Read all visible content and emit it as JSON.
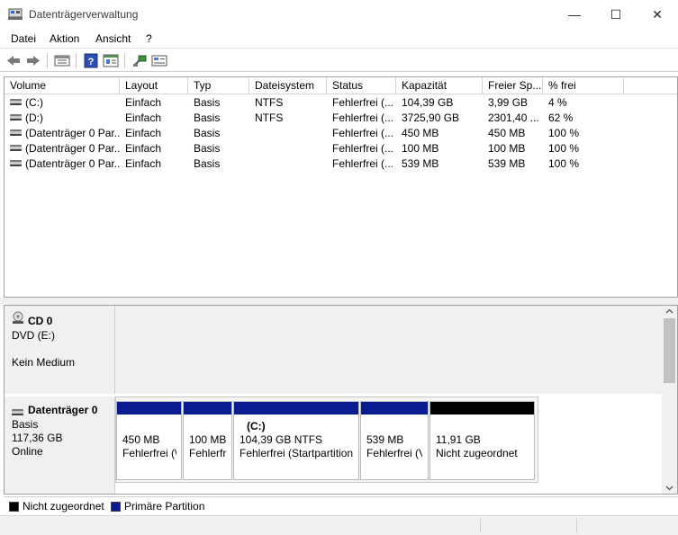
{
  "window": {
    "title": "Datenträgerverwaltung",
    "minimize_glyph": "—",
    "maximize_glyph": "☐",
    "close_glyph": "✕"
  },
  "menu": [
    "Datei",
    "Aktion",
    "Ansicht",
    "?"
  ],
  "toolbar_icons": [
    "back-arrow-icon",
    "forward-arrow-icon",
    "disk-list-icon",
    "help-icon",
    "properties-icon",
    "connect-icon",
    "console-icon"
  ],
  "columns": [
    "Volume",
    "Layout",
    "Typ",
    "Dateisystem",
    "Status",
    "Kapazität",
    "Freier Sp...",
    "% frei"
  ],
  "volumes": [
    {
      "volume": "(C:)",
      "layout": "Einfach",
      "typ": "Basis",
      "fs": "NTFS",
      "status": "Fehlerfrei (...",
      "cap": "104,39 GB",
      "free": "3,99 GB",
      "pct": "4 %"
    },
    {
      "volume": "(D:)",
      "layout": "Einfach",
      "typ": "Basis",
      "fs": "NTFS",
      "status": "Fehlerfrei (...",
      "cap": "3725,90 GB",
      "free": "2301,40 ...",
      "pct": "62 %"
    },
    {
      "volume": "(Datenträger 0 Par...",
      "layout": "Einfach",
      "typ": "Basis",
      "fs": "",
      "status": "Fehlerfrei (...",
      "cap": "450 MB",
      "free": "450 MB",
      "pct": "100 %"
    },
    {
      "volume": "(Datenträger 0 Par...",
      "layout": "Einfach",
      "typ": "Basis",
      "fs": "",
      "status": "Fehlerfrei (...",
      "cap": "100 MB",
      "free": "100 MB",
      "pct": "100 %"
    },
    {
      "volume": "(Datenträger 0 Par...",
      "layout": "Einfach",
      "typ": "Basis",
      "fs": "",
      "status": "Fehlerfrei (...",
      "cap": "539 MB",
      "free": "539 MB",
      "pct": "100 %"
    }
  ],
  "cd": {
    "title": "CD 0",
    "drive": "DVD (E:)",
    "media": "Kein Medium"
  },
  "disk0": {
    "title": "Datenträger 0",
    "type": "Basis",
    "size": "117,36 GB",
    "state": "Online",
    "partitions": [
      {
        "name": "",
        "size": "450 MB",
        "status": "Fehlerfrei (\\",
        "bar": "#0a1c8f"
      },
      {
        "name": "",
        "size": "100 MB",
        "status": "Fehlerfr",
        "bar": "#0a1c8f"
      },
      {
        "name": "(C:)",
        "size": "104,39 GB NTFS",
        "status": "Fehlerfrei (Startpartition",
        "bar": "#0a1c8f"
      },
      {
        "name": "",
        "size": "539 MB",
        "status": "Fehlerfrei (V",
        "bar": "#0a1c8f"
      },
      {
        "name": "",
        "size": "11,91 GB",
        "status": "Nicht zugeordnet",
        "bar": "#000000"
      }
    ]
  },
  "legend": {
    "unallocated": "Nicht zugeordnet",
    "unallocated_color": "#000000",
    "primary": "Primäre Partition",
    "primary_color": "#0a1c8f"
  }
}
